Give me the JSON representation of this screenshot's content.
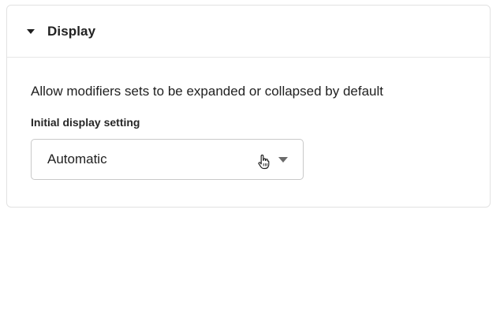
{
  "section": {
    "title": "Display",
    "expanded": true,
    "description": "Allow modifiers sets to be expanded or collapsed by default"
  },
  "field": {
    "label": "Initial display setting",
    "selected_value": "Automatic"
  },
  "icons": {
    "collapse": "caret-down-icon",
    "dropdown": "triangle-down-icon",
    "cursor": "hand-pointer-cursor-icon"
  }
}
